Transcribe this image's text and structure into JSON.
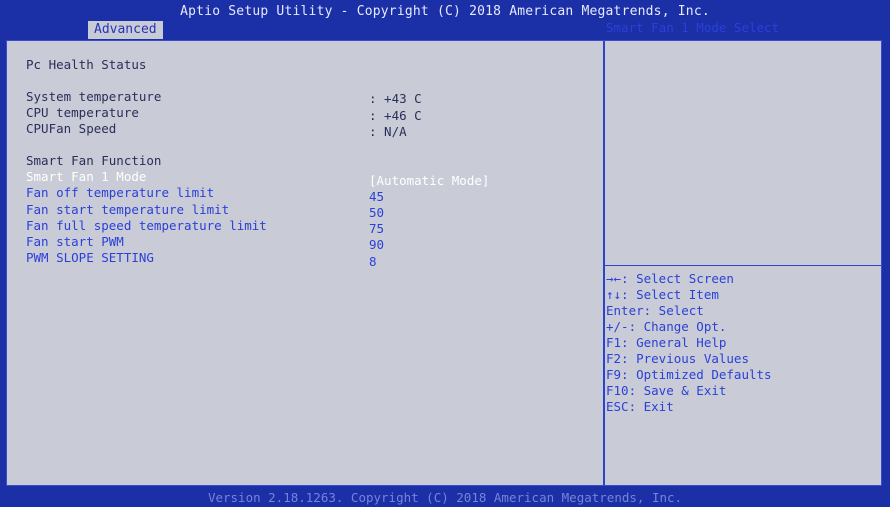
{
  "title": "Aptio Setup Utility - Copyright (C) 2018 American Megatrends, Inc.",
  "active_tab": "Advanced",
  "section": "Pc Health Status",
  "status_items": [
    {
      "label": "System temperature",
      "value": ": +43 C"
    },
    {
      "label": "CPU temperature",
      "value": ": +46 C"
    },
    {
      "label": "CPUFan Speed",
      "value": ": N/A"
    }
  ],
  "smart_fan_heading": "Smart Fan Function",
  "settings": [
    {
      "label": "Smart Fan 1 Mode",
      "value": "[Automatic Mode]"
    },
    {
      "label": "Fan off temperature limit",
      "value": "45"
    },
    {
      "label": "Fan start temperature limit",
      "value": "50"
    },
    {
      "label": "Fan full speed temperature limit",
      "value": "75"
    },
    {
      "label": "Fan start PWM",
      "value": "90"
    },
    {
      "label": "PWM SLOPE SETTING",
      "value": "8"
    }
  ],
  "help_text": "Smart Fan 1 Mode Select",
  "key_help": [
    "→←: Select Screen",
    "↑↓: Select Item",
    "Enter: Select",
    "+/-: Change Opt.",
    "F1: General Help",
    "F2: Previous Values",
    "F9: Optimized Defaults",
    "F10: Save & Exit",
    "ESC: Exit"
  ],
  "footer": "Version 2.18.1263. Copyright (C) 2018 American Megatrends, Inc.",
  "colors": {
    "frame_blue": "#1b2fa6",
    "panel_gray": "#c9ccd6",
    "item_blue": "#2b40d8",
    "selected_white": "#ffffff"
  }
}
